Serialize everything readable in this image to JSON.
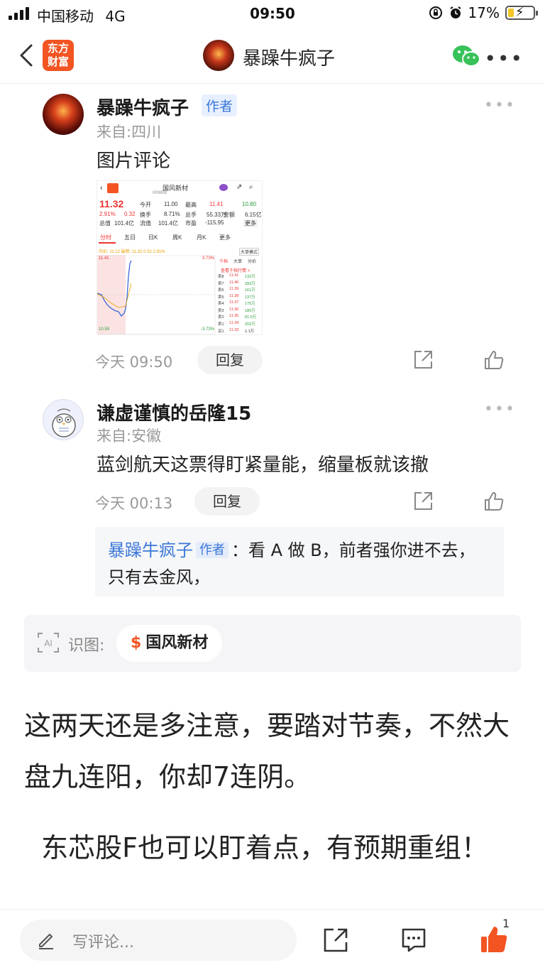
{
  "status_bar": {
    "carrier": "中国移动",
    "network": "4G",
    "time": "09:50",
    "battery": "17%"
  },
  "nav": {
    "logo_line1": "东方",
    "logo_line2": "财富",
    "title": "暴躁牛疯子",
    "more": "•••"
  },
  "comments": [
    {
      "name": "暴躁牛疯子",
      "badge": "作者",
      "from": "来自:四川",
      "text": "图片评论",
      "time": "今天 09:50",
      "reply": "回复",
      "dots": "•••"
    },
    {
      "name": "谦虚谨慎的岳隆15",
      "from": "来自:安徽",
      "text": "蓝剑航天这票得盯紧量能，缩量板就该撤",
      "time": "今天 00:13",
      "reply": "回复",
      "dots": "•••",
      "quote": {
        "name": "暴躁牛疯子",
        "badge": "作者",
        "text": "：看 A 做 B，前者强你进不去，只有去金风，"
      }
    }
  ],
  "stock_shot": {
    "name": "国风新材",
    "code": "000859",
    "price": "11.32",
    "change": "0.32",
    "pct": "2.91%",
    "open_label": "今开",
    "open": "11.00",
    "high_label": "最高",
    "high": "11.41",
    "prev": "10.80",
    "turnover_label": "换手",
    "turnover": "8.71%",
    "vol_label": "总手",
    "vol": "55.33万",
    "amt_label": "金额",
    "amt": "6.15亿",
    "mcap_label": "总值",
    "mcap": "101.4亿",
    "float_label": "流值",
    "float": "101.4亿",
    "pe_label": "市盈",
    "pe": "-115.95",
    "more_label": "更多",
    "tabs": [
      "分时",
      "五日",
      "日K",
      "周K",
      "月K",
      "更多"
    ],
    "avg_line": "均价: 11.12  最新: 11.32  0.32  2.91%",
    "mode": "大单模式",
    "top_price": "11.41",
    "top_pct": "3.73%",
    "bottom_price": "10.59",
    "bottom_pct": "-3.73%",
    "panel_tabs": [
      "千档",
      "大单",
      "分价"
    ],
    "panel_link": "查看千档行情 >",
    "asks": [
      {
        "l": "卖8",
        "p": "11.41",
        "v": "132万"
      },
      {
        "l": "卖7",
        "p": "11.40",
        "v": "393万"
      },
      {
        "l": "卖6",
        "p": "11.39",
        "v": "161万"
      },
      {
        "l": "卖5",
        "p": "11.38",
        "v": "137万"
      },
      {
        "l": "卖4",
        "p": "11.37",
        "v": "175万"
      },
      {
        "l": "卖3",
        "p": "11.36",
        "v": "180万"
      },
      {
        "l": "卖2",
        "p": "11.35",
        "v": "81.0万"
      },
      {
        "l": "卖1",
        "p": "11.34",
        "v": "202万"
      }
    ],
    "bid1": {
      "l": "买1",
      "p": "11.33",
      "v": "1.1万"
    }
  },
  "ai": {
    "icon": "AI",
    "label": "识图:",
    "chip": "国风新材",
    "chip_symbol": "$"
  },
  "post": {
    "para1": "这两天还是多注意，要踏对节奏，不然大盘九连阳，你却7连阴。",
    "para2": "  东芯股F也可以盯着点，有预期重组！"
  },
  "bottom_bar": {
    "placeholder": "写评论...",
    "like_count": "1"
  },
  "colors": {
    "brand": "#f25422",
    "link": "#3a77d8",
    "wechat": "#38c25a"
  }
}
